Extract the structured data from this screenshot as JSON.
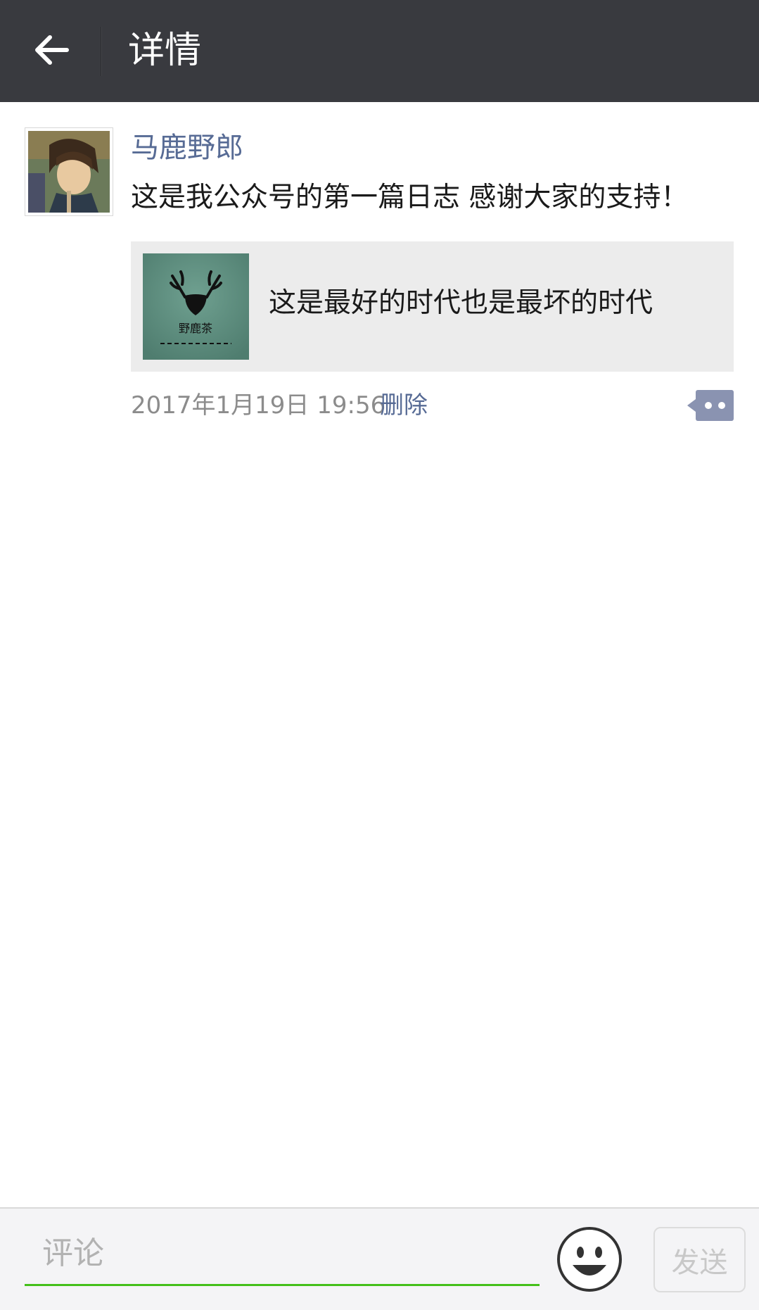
{
  "header": {
    "title": "详情",
    "back_icon": "arrow-left-icon"
  },
  "post": {
    "author": "马鹿野郎",
    "text": "这是我公众号的第一篇日志 感谢大家的支持！",
    "link": {
      "title": "这是最好的时代也是最坏的时代",
      "thumb_text": "野鹿茶"
    },
    "timestamp": "2017年1月19日 19:56",
    "delete_label": "删除",
    "more_icon": "comment-more-icon"
  },
  "composer": {
    "placeholder": "评论",
    "value": "",
    "emoji_icon": "emoji-icon",
    "send_label": "发送"
  },
  "colors": {
    "topbar": "#393a3f",
    "link_blue": "#576b95",
    "input_underline": "#45c01a"
  }
}
